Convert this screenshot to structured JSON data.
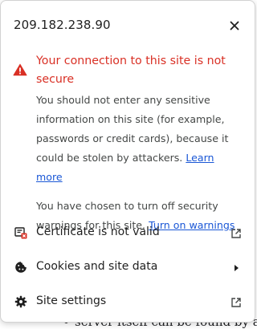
{
  "header": {
    "title": "209.182.238.90"
  },
  "warning": {
    "title": "Your connection to this site is not secure",
    "description": "You should not enter any sensitive information on this site (for example, passwords or credit cards), because it could be stolen by attackers.",
    "learn_more": "Learn more",
    "override_text": "You have chosen to turn off security warnings for this site.",
    "turn_on_link": "Turn on warnings"
  },
  "menu": {
    "items": [
      {
        "label": "Certificate is not valid",
        "icon": "certificate-error-icon",
        "trail": "external-link-icon"
      },
      {
        "label": "Cookies and site data",
        "icon": "cookie-icon",
        "trail": "chevron-right-icon"
      },
      {
        "label": "Site settings",
        "icon": "gear-icon",
        "trail": "external-link-icon"
      }
    ]
  },
  "background_page": {
    "peek_text": "server itself can be found by access"
  },
  "colors": {
    "danger": "#d93025",
    "link": "#1a57d6",
    "text": "#1f1f1f",
    "secondary_text": "#444746"
  }
}
